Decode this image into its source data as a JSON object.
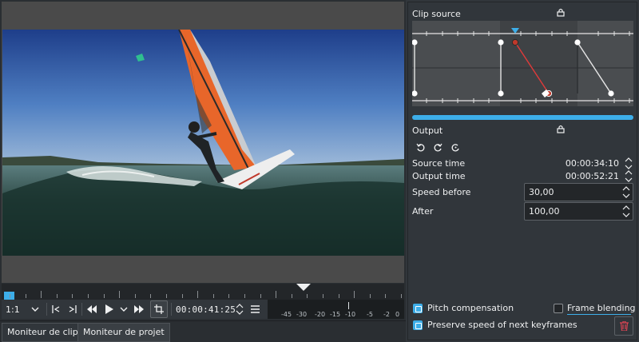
{
  "monitor": {
    "zoom": "1:1",
    "timecode": "00:00:41:25",
    "audio_meter_labels": [
      "-45",
      "-30",
      "-20",
      "-15",
      "-10",
      "-5",
      "-2",
      "0"
    ]
  },
  "tabs": [
    {
      "label": "Moniteur de clip"
    },
    {
      "label": "Moniteur de projet"
    }
  ],
  "panel": {
    "clip_source_label": "Clip source",
    "output_label": "Output",
    "source_time_label": "Source time",
    "source_time_value": "00:00:34:10",
    "output_time_label": "Output time",
    "output_time_value": "00:00:52:21",
    "speed_before_label": "Speed before",
    "speed_before_value": "30,00",
    "after_label": "After",
    "after_value": "100,00",
    "progress_fraction": 1.0,
    "pitch_compensation": {
      "label": "Pitch compensation",
      "checked": true
    },
    "frame_blending": {
      "label": "Frame blending",
      "checked": false
    },
    "preserve_speed": {
      "label": "Preserve speed of next keyframes",
      "checked": true
    }
  },
  "colors": {
    "accent": "#3daee9",
    "keyframe_selected": "#c0392b",
    "panel_bg": "#31363b"
  },
  "icons": [
    "chevron-down-icon",
    "go-to-start-icon",
    "go-to-end-icon",
    "rewind-icon",
    "play-icon",
    "fast-forward-icon",
    "crop-icon",
    "menu-icon",
    "lock-icon",
    "undo-icon",
    "reset-icon",
    "redo-icon",
    "trash-icon"
  ]
}
